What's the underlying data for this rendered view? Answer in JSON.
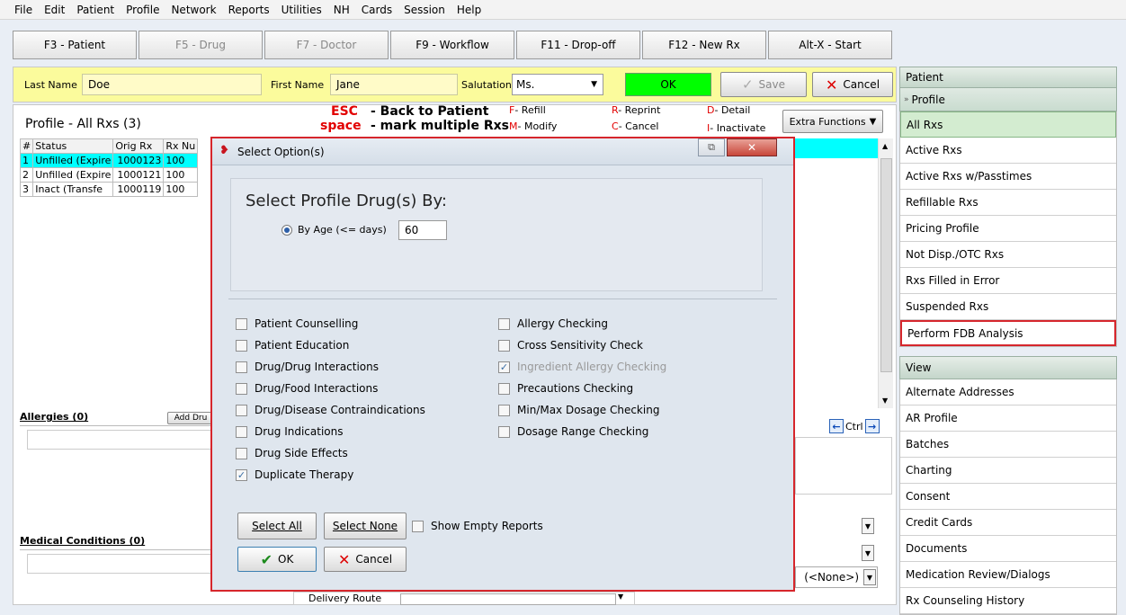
{
  "menu": [
    "File",
    "Edit",
    "Patient",
    "Profile",
    "Network",
    "Reports",
    "Utilities",
    "NH",
    "Cards",
    "Session",
    "Help"
  ],
  "fkeys": [
    {
      "label": "F3 - Patient",
      "w": 138,
      "dis": false
    },
    {
      "label": "F5 - Drug",
      "w": 138,
      "dis": true
    },
    {
      "label": "F7 - Doctor",
      "w": 138,
      "dis": true
    },
    {
      "label": "F9 - Workflow",
      "w": 138,
      "dis": false
    },
    {
      "label": "F11 - Drop-off",
      "w": 138,
      "dis": false
    },
    {
      "label": "F12 - New Rx",
      "w": 138,
      "dis": false
    },
    {
      "label": "Alt-X - Start",
      "w": 138,
      "dis": false
    }
  ],
  "patient": {
    "last_label": "Last Name",
    "last": "Doe",
    "first_label": "First Name",
    "first": "Jane",
    "sal_label": "Salutation",
    "sal": "Ms.",
    "ok": "OK",
    "save": "Save",
    "cancel": "Cancel"
  },
  "profile": {
    "title": "Profile - All Rxs (3)",
    "esc": "ESC",
    "esc_text": "- Back to Patient",
    "space": "space",
    "space_text": "- mark multiple Rxs",
    "f": "F",
    "f_t": "- Refill",
    "m": "M",
    "m_t": "- Modify",
    "r": "R",
    "r_t": "- Reprint",
    "c": "C",
    "c_t": "- Cancel",
    "d": "D",
    "d_t": "- Detail",
    "i": "I",
    "i_t": "- Inactivate",
    "extra": "Extra Functions"
  },
  "grid": {
    "headers": [
      "#",
      "Status",
      "Orig Rx",
      "Rx Nu"
    ],
    "rows": [
      [
        "1",
        "Unfilled (Expire",
        "1000123",
        "100"
      ],
      [
        "2",
        "Unfilled (Expire",
        "1000121",
        "100"
      ],
      [
        "3",
        "Inact (Transfe",
        "1000119",
        "100"
      ]
    ]
  },
  "allergies": {
    "label": "Allergies (0)",
    "add": "Add Dru"
  },
  "medical": {
    "label": "Medical Conditions (0)"
  },
  "delivery": "Delivery Route",
  "ctrl": "Ctrl",
  "none_sel": "(<None>)",
  "dialog": {
    "title": "Select Option(s)",
    "heading": "Select Profile Drug(s) By:",
    "radio": "By Age (<= days)",
    "days": "60",
    "left": [
      {
        "l": "Patient Counselling",
        "c": false
      },
      {
        "l": "Patient Education",
        "c": false
      },
      {
        "l": "Drug/Drug Interactions",
        "c": false
      },
      {
        "l": "Drug/Food Interactions",
        "c": false
      },
      {
        "l": "Drug/Disease Contraindications",
        "c": false
      },
      {
        "l": "Drug Indications",
        "c": false
      },
      {
        "l": "Drug Side Effects",
        "c": false
      },
      {
        "l": "Duplicate Therapy",
        "c": true
      }
    ],
    "right": [
      {
        "l": "Allergy Checking",
        "c": false
      },
      {
        "l": "Cross Sensitivity Check",
        "c": false
      },
      {
        "l": "Ingredient Allergy Checking",
        "c": true,
        "dis": true
      },
      {
        "l": "Precautions Checking",
        "c": false
      },
      {
        "l": "Min/Max Dosage Checking",
        "c": false
      },
      {
        "l": "Dosage Range Checking",
        "c": false
      }
    ],
    "select_all": "Select All",
    "select_none": "Select None",
    "show_empty": "Show Empty Reports",
    "ok": "OK",
    "cancel": "Cancel"
  },
  "side": {
    "patient": "Patient",
    "profile": "Profile",
    "profile_items": [
      "All Rxs",
      "Active Rxs",
      "Active Rxs w/Passtimes",
      "Refillable Rxs",
      "Pricing Profile",
      "Not Disp./OTC Rxs",
      "Rxs Filled in Error",
      "Suspended Rxs",
      "Perform FDB Analysis"
    ],
    "view": "View",
    "view_items": [
      "Alternate Addresses",
      "AR Profile",
      "Batches",
      "Charting",
      "Consent",
      "Credit Cards",
      "Documents",
      "Medication Review/Dialogs",
      "Rx Counseling History"
    ]
  },
  "colors": {
    "selected_row": "#00ffff",
    "highlight_border": "#d6262c",
    "ok_green": "#00ff00"
  }
}
